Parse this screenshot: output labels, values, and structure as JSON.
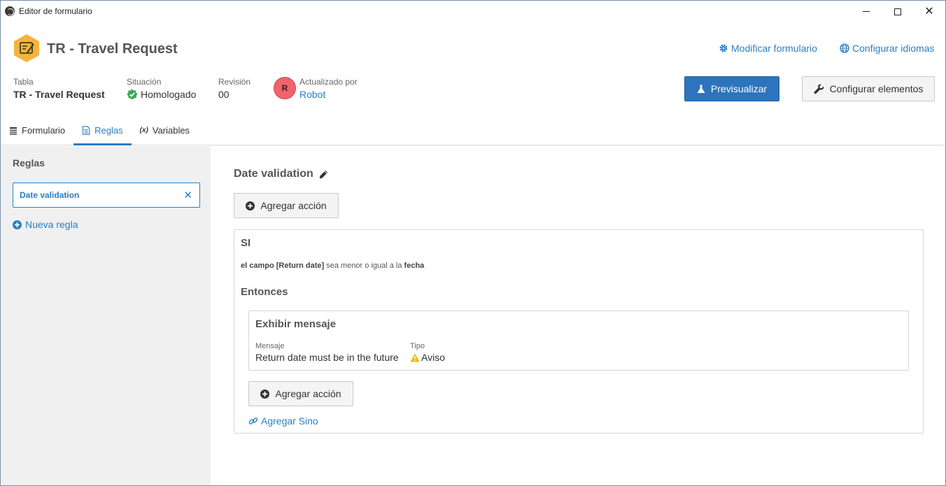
{
  "window": {
    "title": "Editor de formulario",
    "minimize_icon": "minimize-icon",
    "maximize_icon": "maximize-icon",
    "close_label": "✕"
  },
  "header": {
    "form_title": "TR - Travel Request",
    "logo_icon": "form-edit-icon",
    "logo_color": "#f4b33f",
    "links": {
      "modify": "Modificar formulario",
      "languages": "Configurar idiomas"
    },
    "meta": {
      "tabla_label": "Tabla",
      "tabla_value": "TR - Travel Request",
      "situacion_label": "Situación",
      "situacion_value": "Homologado",
      "revision_label": "Revisión",
      "revision_value": "00",
      "updated_label": "Actualizado por",
      "updated_value": "Robot",
      "avatar_initial": "R",
      "avatar_color": "#f0636d"
    },
    "buttons": {
      "preview": "Previsualizar",
      "configure": "Configurar elementos"
    },
    "tabs": [
      {
        "label": "Formulario",
        "icon": "form-list-icon",
        "active": false
      },
      {
        "label": "Reglas",
        "icon": "document-icon",
        "active": true
      },
      {
        "label": "Variables",
        "icon": "variable-x-icon",
        "active": false
      }
    ],
    "tab_variable_glyph": "(x)"
  },
  "sidebar": {
    "title": "Reglas",
    "rules": [
      {
        "label": "Date validation",
        "selected": true
      }
    ],
    "remove_glyph": "✕",
    "new_rule": "Nueva regla"
  },
  "main": {
    "rule_title": "Date validation",
    "add_action": "Agregar acción",
    "condition": {
      "si": "SI",
      "text_part1": "el campo [Return date]",
      "text_part2": " sea menor o igual a la ",
      "text_part3": "fecha"
    },
    "then_label": "Entonces",
    "action": {
      "title": "Exhibir mensaje",
      "message_label": "Mensaje",
      "message_value": "Return date must be in the future",
      "type_label": "Tipo",
      "type_value": "Aviso"
    },
    "inner_add_action": "Agregar acción",
    "add_else": "Agregar Sino"
  },
  "colors": {
    "accent": "#2a7ec3",
    "primary_button": "#2c74bd",
    "sidebar_bg": "#f0f0f0",
    "success": "#3aa655",
    "warning": "#f2b90f"
  }
}
